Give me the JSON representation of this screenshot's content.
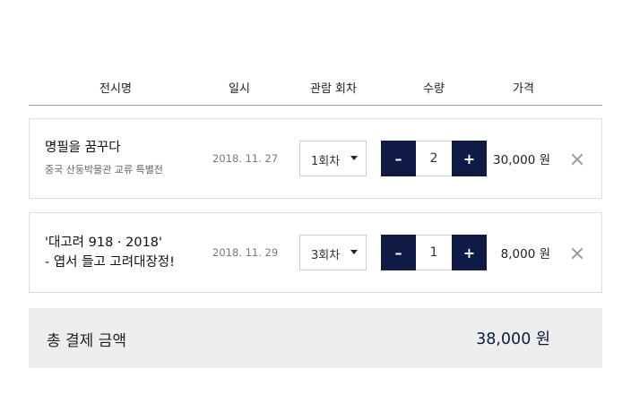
{
  "header": {
    "name": "전시명",
    "date": "일시",
    "round": "관람 회차",
    "quantity": "수량",
    "price": "가격"
  },
  "items": [
    {
      "title": "명필을 꿈꾸다",
      "subtitle": "중국 산둥박물관 교류 특별전",
      "date": "2018. 11. 27",
      "round": "1회차",
      "quantity": "2",
      "price": "30,000 원"
    },
    {
      "title_line1": "'대고려 918 · 2018'",
      "title_line2": "- 엽서 들고 고려대장정!",
      "date": "2018. 11. 29",
      "round": "3회차",
      "quantity": "1",
      "price": "8,000 원"
    }
  ],
  "stepper": {
    "minus": "–",
    "plus": "+"
  },
  "total": {
    "label": "총 결제 금액",
    "amount": "38,000 원"
  },
  "colors": {
    "accent": "#0f1a45",
    "total_bg": "#eeeeee",
    "border": "#dddddd"
  }
}
